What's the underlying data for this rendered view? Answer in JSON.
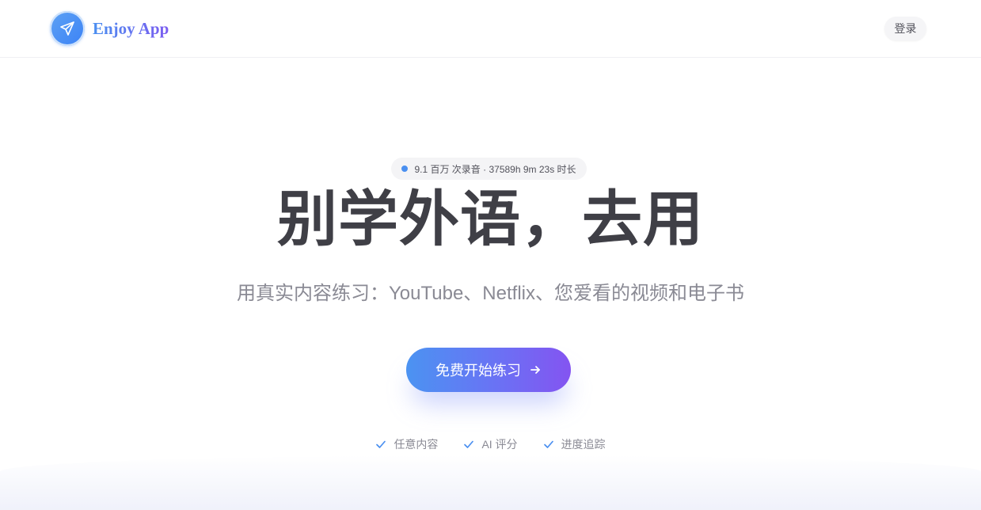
{
  "header": {
    "brand_name": "Enjoy App",
    "login_label": "登录"
  },
  "hero": {
    "stats_text": "9.1 百万 次录音 · 37589h 9m 23s 时长",
    "headline": "别学外语，去用",
    "subtitle": "用真实内容练习：YouTube、Netflix、您爱看的视频和电子书",
    "cta_label": "免费开始练习",
    "features": [
      {
        "label": "任意内容"
      },
      {
        "label": "AI 评分"
      },
      {
        "label": "进度追踪"
      }
    ]
  },
  "icons": {
    "logo": "paper-plane-icon",
    "cta": "arrow-right-icon",
    "feature": "check-icon",
    "stats": "status-dot-icon"
  },
  "colors": {
    "brand_blue": "#4a8ff0",
    "brand_purple": "#7b5cf0",
    "cta_gradient_start": "#4b93f2",
    "cta_gradient_end": "#8454f1",
    "text_dark": "#3f3f46",
    "text_muted": "#8a8a94"
  }
}
